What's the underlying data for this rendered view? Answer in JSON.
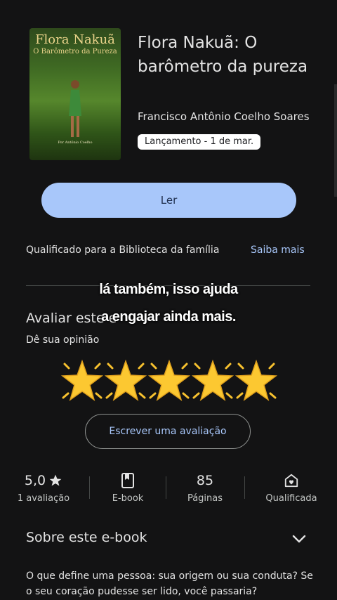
{
  "book": {
    "cover_title": "Flora Nakuã",
    "cover_subtitle": "O Barômetro da Pureza",
    "cover_author": "Por Antônio Coelho",
    "title": "Flora Nakuã: O barômetro da pureza",
    "author": "Francisco Antônio Coelho Soares",
    "release_badge": "Lançamento - 1 de mar."
  },
  "actions": {
    "read_label": "Ler",
    "family_text": "Qualificado para a Biblioteca da família",
    "learn_more": "Saiba mais"
  },
  "rating_section": {
    "heading": "Avaliar este e",
    "subheading": "Dê sua opinião",
    "write_review": "Escrever uma avaliação",
    "stars": 5
  },
  "caption": {
    "line1": "lá também, isso ajuda",
    "line2": "a engajar ainda mais."
  },
  "stats": {
    "rating_value": "5,0",
    "rating_label": "1 avaliação",
    "format_label": "E-book",
    "pages_value": "85",
    "pages_label": "Páginas",
    "qualified_label": "Qualificada"
  },
  "about": {
    "heading": "Sobre este e-book",
    "description": "O que define uma pessoa: sua origem ou sua conduta? Se o seu coração pudesse ser lido, você passaria?"
  },
  "colors": {
    "background": "#131314",
    "accent": "#a8c7fa",
    "star": "#f7c12f"
  }
}
